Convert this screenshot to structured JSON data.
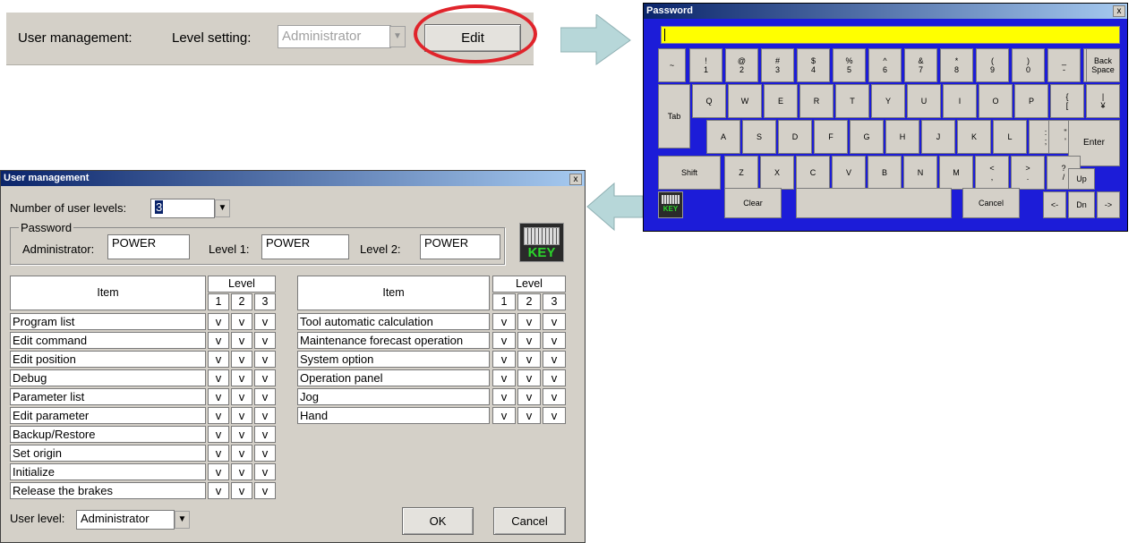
{
  "top": {
    "user_management_label": "User management:",
    "level_setting_label": "Level setting:",
    "level_value": "Administrator",
    "edit_button": "Edit"
  },
  "password_window": {
    "title": "Password",
    "close": "x",
    "input_value": "",
    "row1": [
      [
        "~",
        ""
      ],
      [
        "!",
        "1"
      ],
      [
        "@",
        "2"
      ],
      [
        "#",
        "3"
      ],
      [
        "$",
        "4"
      ],
      [
        "%",
        "5"
      ],
      [
        "^",
        "6"
      ],
      [
        "&",
        "7"
      ],
      [
        "*",
        "8"
      ],
      [
        "(",
        "9"
      ],
      [
        ")",
        "0"
      ],
      [
        "_",
        "-"
      ],
      [
        "+",
        "="
      ],
      [
        "Back",
        "Space"
      ]
    ],
    "row2": [
      "Q",
      "W",
      "E",
      "R",
      "T",
      "Y",
      "U",
      "I",
      "O",
      "P",
      [
        "{",
        "["
      ],
      [
        "}",
        "]"
      ],
      [
        "|",
        "¥"
      ]
    ],
    "tab": "Tab",
    "row3": [
      "A",
      "S",
      "D",
      "F",
      "G",
      "H",
      "J",
      "K",
      "L",
      [
        ":",
        ";"
      ],
      [
        "\"",
        "'"
      ]
    ],
    "enter": "Enter",
    "shift": "Shift",
    "row4": [
      "Z",
      "X",
      "C",
      "V",
      "B",
      "N",
      "M",
      [
        "<",
        ","
      ],
      [
        ">",
        "."
      ],
      [
        "?",
        "/"
      ]
    ],
    "up": "Up",
    "clear": "Clear",
    "cancel": "Cancel",
    "left": "<-",
    "dn": "Dn",
    "right": "->",
    "key_icon_text": "KEY"
  },
  "user_window": {
    "title": "User management",
    "close": "x",
    "num_levels_label": "Number of user levels:",
    "num_levels_value": "3",
    "password_group": "Password",
    "admin_label": "Administrator:",
    "admin_value": "POWER",
    "level1_label": "Level 1:",
    "level1_value": "POWER",
    "level2_label": "Level 2:",
    "level2_value": "POWER",
    "key_icon_text": "KEY",
    "item_header": "Item",
    "level_header": "Level",
    "level_cols": [
      "1",
      "2",
      "3"
    ],
    "left_items": [
      {
        "name": "Program list",
        "v": [
          "v",
          "v",
          "v"
        ]
      },
      {
        "name": "Edit command",
        "v": [
          "v",
          "v",
          "v"
        ]
      },
      {
        "name": "Edit position",
        "v": [
          "v",
          "v",
          "v"
        ]
      },
      {
        "name": "Debug",
        "v": [
          "v",
          "v",
          "v"
        ]
      },
      {
        "name": "Parameter list",
        "v": [
          "v",
          "v",
          "v"
        ]
      },
      {
        "name": "Edit parameter",
        "v": [
          "v",
          "v",
          "v"
        ]
      },
      {
        "name": "Backup/Restore",
        "v": [
          "v",
          "v",
          "v"
        ]
      },
      {
        "name": "Set origin",
        "v": [
          "v",
          "v",
          "v"
        ]
      },
      {
        "name": "Initialize",
        "v": [
          "v",
          "v",
          "v"
        ]
      },
      {
        "name": "Release the brakes",
        "v": [
          "v",
          "v",
          "v"
        ]
      }
    ],
    "right_items": [
      {
        "name": "Tool automatic calculation",
        "v": [
          "v",
          "v",
          "v"
        ]
      },
      {
        "name": "Maintenance forecast operation",
        "v": [
          "v",
          "v",
          "v"
        ]
      },
      {
        "name": "System option",
        "v": [
          "v",
          "v",
          "v"
        ]
      },
      {
        "name": "Operation panel",
        "v": [
          "v",
          "v",
          "v"
        ]
      },
      {
        "name": "Jog",
        "v": [
          "v",
          "v",
          "v"
        ]
      },
      {
        "name": "Hand",
        "v": [
          "v",
          "v",
          "v"
        ]
      }
    ],
    "user_level_label": "User level:",
    "user_level_value": "Administrator",
    "ok": "OK",
    "cancel": "Cancel"
  },
  "colors": {
    "highlight_circle": "#e0242b",
    "arrow": "#b7d7d9",
    "keyboard_bg": "#1c1cd8",
    "input_yellow": "#ffff00"
  }
}
